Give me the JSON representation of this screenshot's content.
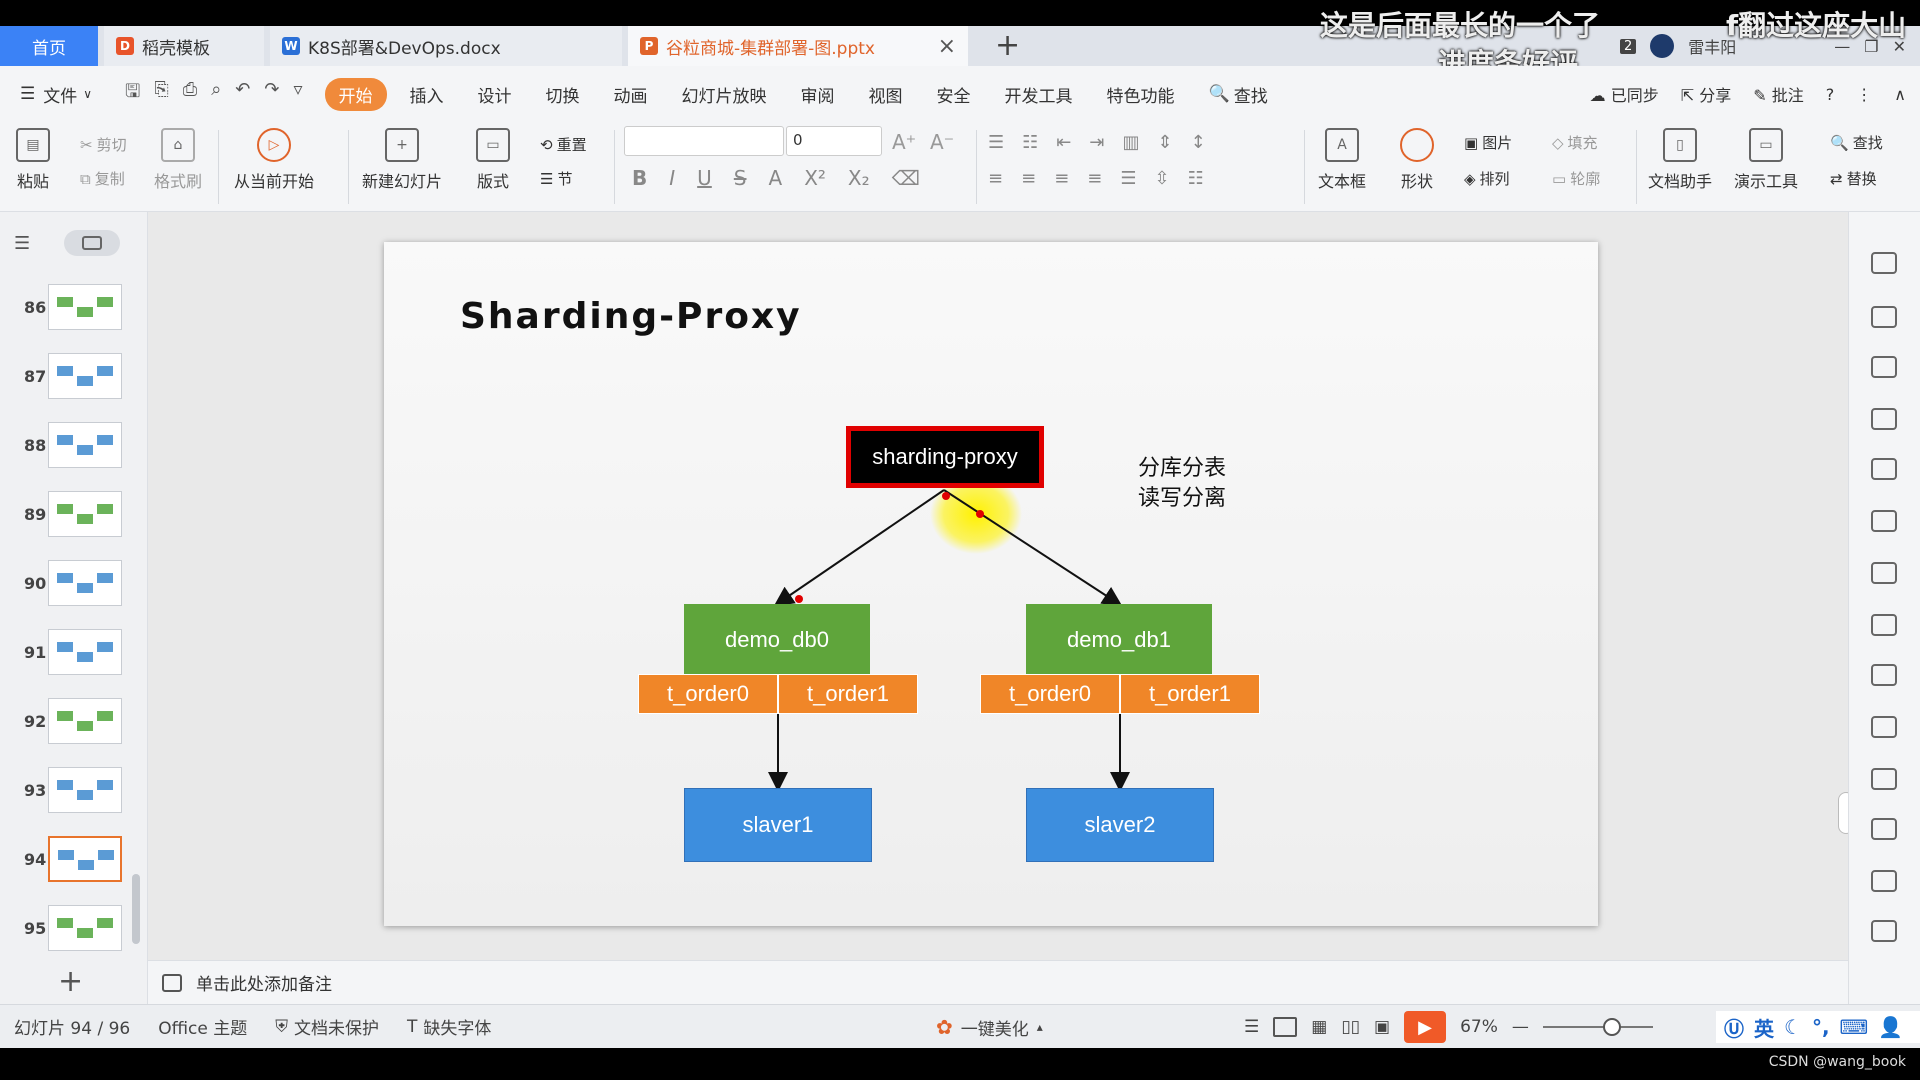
{
  "overlay": {
    "line1": "这是后面最长的一个了",
    "line2": "进度条好评",
    "line3": "f翻过这座大山",
    "badge": "2"
  },
  "tabs": {
    "home": "首页",
    "items": [
      {
        "label": "稻壳模板",
        "icon_color": "#e8542a"
      },
      {
        "label": "K8S部署&DevOps.docx",
        "icon_color": "#2b6fd6"
      },
      {
        "label": "谷粒商城-集群部署-图.pptx",
        "icon_color": "#e0642b"
      }
    ],
    "user": "雷丰阳"
  },
  "menu": {
    "file": "文件",
    "items": [
      "开始",
      "插入",
      "设计",
      "切换",
      "动画",
      "幻灯片放映",
      "审阅",
      "视图",
      "安全",
      "开发工具",
      "特色功能"
    ],
    "active": "开始",
    "search": "查找",
    "sync": "已同步",
    "share": "分享",
    "comment": "批注",
    "help": "?"
  },
  "ribbon": {
    "paste": "粘贴",
    "cut": "剪切",
    "copy": "复制",
    "format_painter": "格式刷",
    "from_current": "从当前开始",
    "new_slide": "新建幻灯片",
    "layout": "版式",
    "reset": "重置",
    "section": "节",
    "font_size": "0",
    "textbox": "文本框",
    "shape": "形状",
    "picture": "图片",
    "fill": "填充",
    "arrange": "排列",
    "outline": "轮廓",
    "doc_assistant": "文档助手",
    "present_tools": "演示工具",
    "find": "查找",
    "replace": "替换"
  },
  "thumbnails": [
    {
      "num": "86"
    },
    {
      "num": "87"
    },
    {
      "num": "88"
    },
    {
      "num": "89"
    },
    {
      "num": "90"
    },
    {
      "num": "91"
    },
    {
      "num": "92"
    },
    {
      "num": "93"
    },
    {
      "num": "94",
      "active": true
    },
    {
      "num": "95"
    }
  ],
  "slide": {
    "title": "Sharding-Proxy",
    "proxy": "sharding-proxy",
    "note_line1": "分库分表",
    "note_line2": "读写分离",
    "db0": "demo_db0",
    "db1": "demo_db1",
    "db0_tables": [
      "t_order0",
      "t_order1"
    ],
    "db1_tables": [
      "t_order0",
      "t_order1"
    ],
    "slaver1": "slaver1",
    "slaver2": "slaver2",
    "colors": {
      "proxy_bg": "#000000",
      "proxy_border": "#e00000",
      "db": "#5fa53b",
      "table": "#f08628",
      "slaver": "#3d8ede"
    }
  },
  "notes": {
    "placeholder": "单击此处添加备注"
  },
  "status": {
    "slide_counter": "幻灯片 94 / 96",
    "theme": "Office 主题",
    "protect": "文档未保护",
    "missing_font": "缺失字体",
    "beautify": "一键美化",
    "zoom": "67%",
    "ime": "英"
  },
  "watermark": "CSDN @wang_book"
}
